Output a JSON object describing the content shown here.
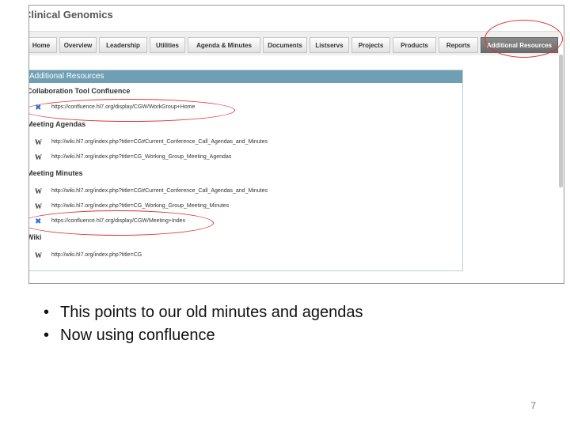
{
  "site_title": "Clinical Genomics",
  "nav": {
    "tabs": [
      "Home",
      "Overview",
      "Leadership",
      "Utilities",
      "Agenda & Minutes",
      "Documents",
      "Listservs",
      "Projects",
      "Products",
      "Reports",
      "Additional Resources"
    ],
    "active": "Additional Resources"
  },
  "panel": {
    "title": "Additional Resources",
    "sections": [
      {
        "heading": "Collaboration Tool Confluence",
        "links": [
          {
            "icon": "confluence-icon",
            "url": "https://confluence.hl7.org/display/CGW/WorkGroup+Home"
          }
        ]
      },
      {
        "heading": "Meeting Agendas",
        "links": [
          {
            "icon": "wiki-icon",
            "url": "http://wiki.hl7.org/index.php?title=CG#Current_Conference_Call_Agendas_and_Minutes"
          },
          {
            "icon": "wiki-icon",
            "url": "http://wiki.hl7.org/index.php?title=CG_Working_Group_Meeting_Agendas"
          }
        ]
      },
      {
        "heading": "Meeting Minutes",
        "links": [
          {
            "icon": "wiki-icon",
            "url": "http://wiki.hl7.org/index.php?title=CG#Current_Conference_Call_Agendas_and_Minutes"
          },
          {
            "icon": "wiki-icon",
            "url": "http://wiki.hl7.org/index.php?title=CG_Working_Group_Meeting_Minutes"
          },
          {
            "icon": "confluence-icon",
            "url": "https://confluence.hl7.org/display/CGW/Meeting+Index"
          }
        ]
      },
      {
        "heading": "Wiki",
        "links": [
          {
            "icon": "wiki-icon",
            "url": "http://wiki.hl7.org/index.php?title=CG"
          }
        ]
      }
    ]
  },
  "bullets": [
    "This points to our old minutes and agendas",
    "Now using confluence"
  ],
  "page_number": "7",
  "colors": {
    "panel_header": "#6f9fb4",
    "highlight_circle": "#dd3333",
    "confluence_icon": "#1f6fd1"
  }
}
